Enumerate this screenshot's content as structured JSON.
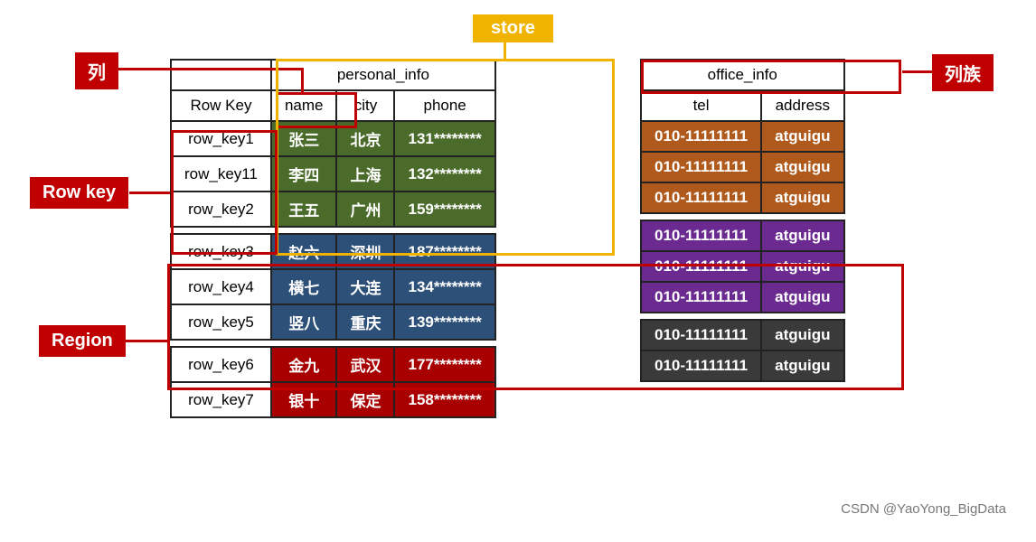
{
  "labels": {
    "store": "store",
    "column": "列",
    "rowkey": "Row key",
    "region": "Region",
    "cf": "列族"
  },
  "cf1": {
    "header": "personal_info",
    "cols": {
      "rk": "Row Key",
      "c1": "name",
      "c2": "city",
      "c3": "phone"
    },
    "r1": [
      {
        "rk": "row_key1",
        "c1": "张三",
        "c2": "北京",
        "c3": "131********"
      },
      {
        "rk": "row_key11",
        "c1": "李四",
        "c2": "上海",
        "c3": "132********"
      },
      {
        "rk": "row_key2",
        "c1": "王五",
        "c2": "广州",
        "c3": "159********"
      }
    ],
    "r2": [
      {
        "rk": "row_key3",
        "c1": "赵六",
        "c2": "深圳",
        "c3": "187********"
      },
      {
        "rk": "row_key4",
        "c1": "横七",
        "c2": "大连",
        "c3": "134********"
      },
      {
        "rk": "row_key5",
        "c1": "竖八",
        "c2": "重庆",
        "c3": "139********"
      }
    ],
    "r3": [
      {
        "rk": "row_key6",
        "c1": "金九",
        "c2": "武汉",
        "c3": "177********"
      },
      {
        "rk": "row_key7",
        "c1": "银十",
        "c2": "保定",
        "c3": "158********"
      }
    ]
  },
  "cf2": {
    "header": "office_info",
    "cols": {
      "c1": "tel",
      "c2": "address"
    },
    "r1": [
      {
        "c1": "010-11111111",
        "c2": "atguigu"
      },
      {
        "c1": "010-11111111",
        "c2": "atguigu"
      },
      {
        "c1": "010-11111111",
        "c2": "atguigu"
      }
    ],
    "r2": [
      {
        "c1": "010-11111111",
        "c2": "atguigu"
      },
      {
        "c1": "010-11111111",
        "c2": "atguigu"
      },
      {
        "c1": "010-11111111",
        "c2": "atguigu"
      }
    ],
    "r3": [
      {
        "c1": "010-11111111",
        "c2": "atguigu"
      },
      {
        "c1": "010-11111111",
        "c2": "atguigu"
      }
    ]
  },
  "watermark": "CSDN @YaoYong_BigData"
}
